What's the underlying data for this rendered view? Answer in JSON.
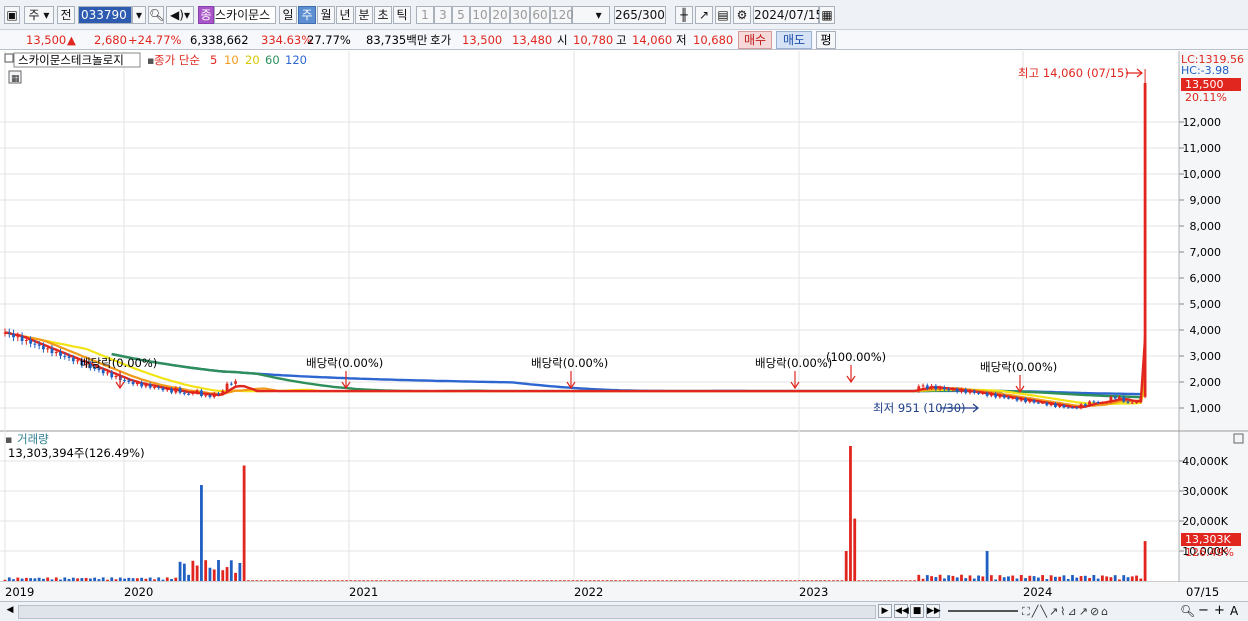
{
  "toolbar": {
    "market_type": "주",
    "prev_label": "전",
    "stock_code": "033790",
    "badge": "종",
    "stock_name": "스카이문스",
    "periods": [
      "일",
      "주",
      "월",
      "년",
      "분",
      "초",
      "틱"
    ],
    "selected_period": "주",
    "intervals": [
      "1",
      "3",
      "5",
      "10",
      "20",
      "30",
      "60",
      "120"
    ],
    "count_value": "265",
    "count_max": "/300",
    "date": "2024/07/15"
  },
  "quote": {
    "price": "13,500",
    "direction": "▲",
    "change": "2,680",
    "change_pct": "+24.77%",
    "volume": "6,338,662",
    "volume_ratio": "334.63%",
    "turnover": "27.77%",
    "amount": "83,735백만",
    "hoga_label": "호가",
    "ask": "13,500",
    "bid": "13,480",
    "open_label": "시",
    "open": "10,780",
    "high_label": "고",
    "high": "14,060",
    "low_label": "저",
    "low": "10,680",
    "buy_label": "매수",
    "sell_label": "매도",
    "eval_label": "평"
  },
  "price_panel": {
    "title": "스카이문스테크놀로지",
    "ma_label": "종가 단순",
    "ma_periods": [
      {
        "label": "5",
        "color": "#e0261e"
      },
      {
        "label": "10",
        "color": "#f29a1a"
      },
      {
        "label": "20",
        "color": "#f2e414"
      },
      {
        "label": "60",
        "color": "#2f8f5a"
      },
      {
        "label": "120",
        "color": "#2e66d1"
      }
    ],
    "lc_label": "LC:1319.56",
    "hc_label": "HC:-3.98",
    "current_price_tag": "13,500",
    "current_pct_tag": "20.11%",
    "y_ticks": [
      "12,000",
      "11,000",
      "10,000",
      "9,000",
      "8,000",
      "7,000",
      "6,000",
      "5,000",
      "4,000",
      "3,000",
      "2,000",
      "1,000"
    ],
    "high_note": "최고 14,060 (07/15)",
    "low_note": "최저 951 (10/30)",
    "dividend_notes": [
      "배당락(0.00%)",
      "배당락(0.00%)",
      "배당락(0.00%)",
      "배당락(0.00%)",
      "(100.00%)",
      "배당락(0.00%)"
    ]
  },
  "volume_panel": {
    "title": "거래량",
    "summary": "13,303,394주(126.49%)",
    "y_ticks": [
      "40,000K",
      "30,000K",
      "20,000K",
      "10,000K"
    ],
    "current_tag": "13,303K",
    "current_pct_tag": "126.49%"
  },
  "x_axis": {
    "labels": [
      "2019",
      "2020",
      "2021",
      "2022",
      "2023",
      "2024"
    ],
    "right_label": "07/15"
  },
  "colors": {
    "up": "#e0261e",
    "down": "#1f5fc2",
    "ma5": "#e0261e",
    "ma10": "#f29a1a",
    "ma20": "#f2e414",
    "ma60": "#2f8f5a",
    "ma120": "#2e66d1"
  }
}
